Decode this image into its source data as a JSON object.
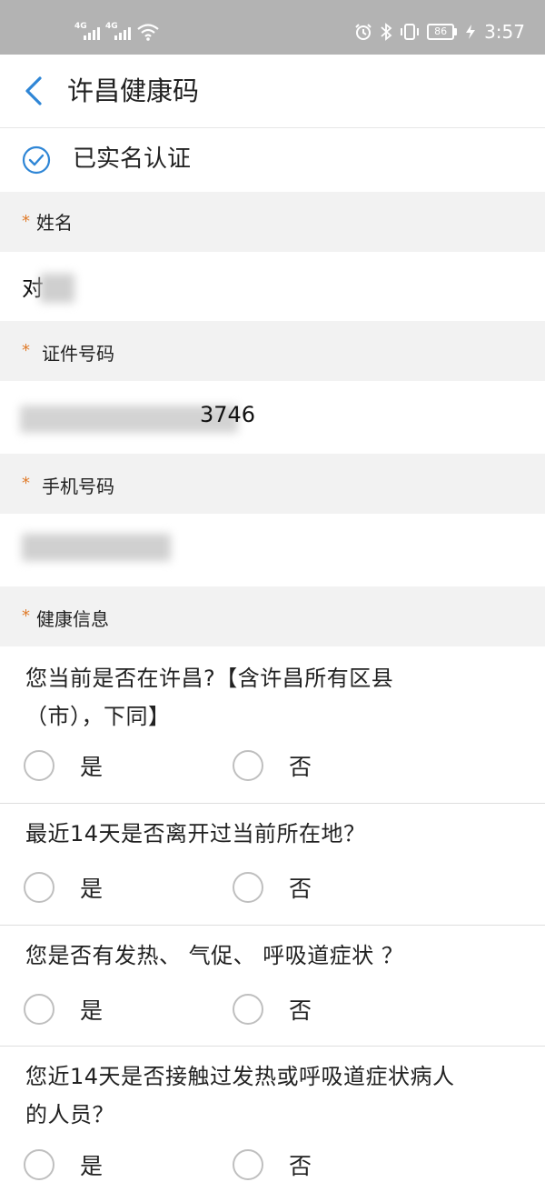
{
  "status_bar": {
    "sim1": "4G",
    "sim2": "4G",
    "battery": "86",
    "time": "3:57"
  },
  "nav": {
    "title": "许昌健康码"
  },
  "verified": {
    "text": "已实名认证"
  },
  "form": {
    "name": {
      "label": "姓名",
      "value_visible": "对"
    },
    "id_number": {
      "label": "证件号码",
      "value_visible": "3746"
    },
    "phone": {
      "label": "手机号码"
    },
    "health": {
      "label": "健康信息"
    }
  },
  "questions": [
    {
      "line1": "您当前是否在许昌?【含许昌所有区县",
      "line2": "（市），下同】",
      "yes": "是",
      "no": "否"
    },
    {
      "line1": "最近14天是否离开过当前所在地？",
      "line2": "",
      "yes": "是",
      "no": "否"
    },
    {
      "line1": "您是否有发热、 气促、 呼吸道症状 ？",
      "line2": "",
      "yes": "是",
      "no": "否"
    },
    {
      "line1": "您近14天是否接触过发热或呼吸道症状病人",
      "line2": "的人员？",
      "yes": "是",
      "no": "否"
    }
  ],
  "colors": {
    "accent": "#2f86d6",
    "required_star": "#e07b2a",
    "section_bg": "#f2f2f2",
    "statusbar_bg": "#b3b3b3"
  },
  "icons": [
    "back-chevron-icon",
    "verified-check-icon",
    "signal-icon",
    "wifi-icon",
    "alarm-icon",
    "bluetooth-icon",
    "vibrate-icon",
    "battery-icon"
  ]
}
